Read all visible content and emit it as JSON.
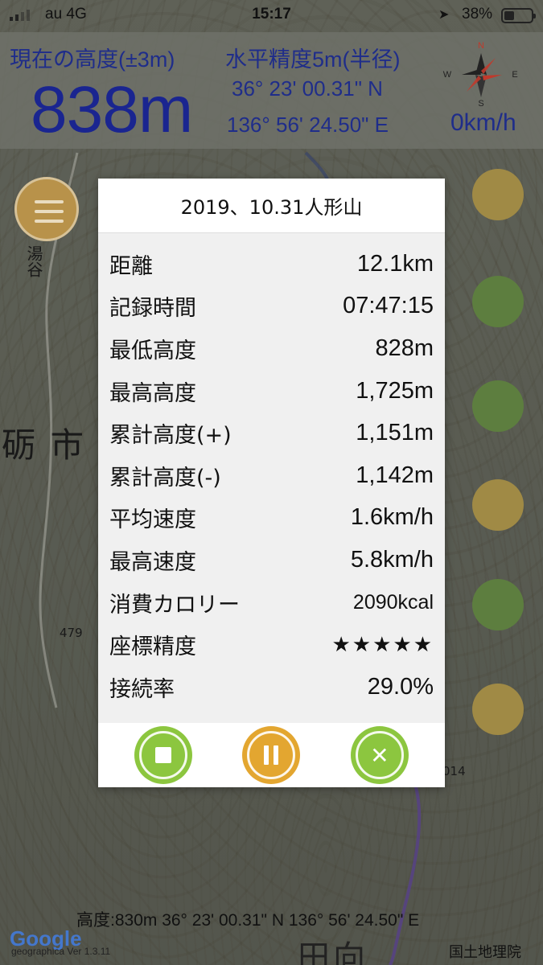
{
  "status_bar": {
    "carrier": "au 4G",
    "time": "15:17",
    "battery": "38%"
  },
  "header": {
    "altitude_label": "現在の高度(±3m)",
    "altitude_value": "838m",
    "accuracy_label": "水平精度5m(半径)",
    "latitude": "36° 23' 00.31\" N",
    "longitude": "136° 56' 24.50\" E",
    "speed": "0km/h",
    "compass": {
      "n": "N",
      "s": "S",
      "e": "E",
      "w": "W"
    }
  },
  "map": {
    "labels": {
      "city": "砺市",
      "yutani": "湯谷",
      "elev_479": "479",
      "elev_014": "014",
      "place_bottom": "田向"
    },
    "footer": "高度:830m  36° 23' 00.31\" N 136° 56' 24.50\" E",
    "google": "Google",
    "version": "geographica Ver 1.3.11",
    "gsi": "国土地理院"
  },
  "modal": {
    "title": "2019、10.31人形山",
    "rows": [
      {
        "label": "距離",
        "value": "12.1km"
      },
      {
        "label": "記録時間",
        "value": "07:47:15"
      },
      {
        "label": "最低高度",
        "value": "828m"
      },
      {
        "label": "最高高度",
        "value": "1,725m"
      },
      {
        "label": "累計高度(+)",
        "value": "1,151m"
      },
      {
        "label": "累計高度(-)",
        "value": "1,142m"
      },
      {
        "label": "平均速度",
        "value": "1.6km/h"
      },
      {
        "label": "最高速度",
        "value": "5.8km/h"
      },
      {
        "label": "消費カロリー",
        "value": "2090kcal"
      },
      {
        "label": "座標精度",
        "value": "★★★★★"
      },
      {
        "label": "接続率",
        "value": "29.0%"
      }
    ]
  },
  "colors": {
    "accent_green": "#8cc63f",
    "accent_orange": "#e3a630",
    "header_text": "#1f2d8a"
  }
}
